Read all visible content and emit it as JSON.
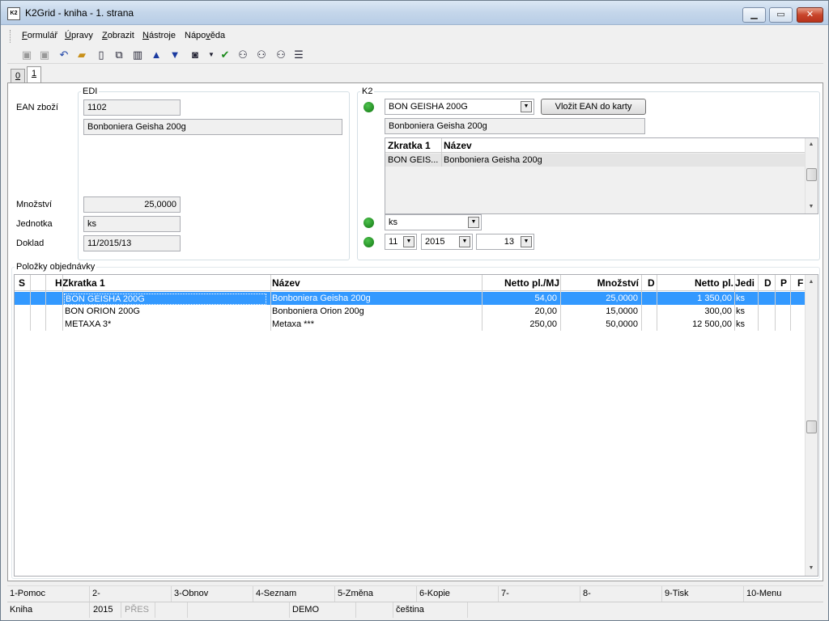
{
  "window": {
    "title": "K2Grid - kniha - 1. strana",
    "icon": "k2-app-icon"
  },
  "menu": [
    {
      "pre": "",
      "u": "F",
      "post": "ormulář"
    },
    {
      "pre": "",
      "u": "Ú",
      "post": "pravy"
    },
    {
      "pre": "",
      "u": "Z",
      "post": "obrazit"
    },
    {
      "pre": "",
      "u": "N",
      "post": "ástroje"
    },
    {
      "pre": "Nápo",
      "u": "v",
      "post": "ěda"
    }
  ],
  "tabs": [
    "0",
    "1"
  ],
  "edi": {
    "group_label": "EDI",
    "ean_label": "EAN zboží",
    "ean_value": "1102",
    "name_value": "Bonboniera Geisha 200g",
    "qty_label": "Množství",
    "qty_value": "25,0000",
    "unit_label": "Jednotka",
    "unit_value": "ks",
    "doc_label": "Doklad",
    "doc_value": "11/2015/13"
  },
  "k2": {
    "group_label": "K2",
    "product_combo": "BON GEISHA 200G",
    "ean_button": "Vložit EAN do karty",
    "name_value": "Bonboniera Geisha 200g",
    "mini_grid": {
      "headers": [
        "Zkratka 1",
        "Název"
      ],
      "rows": [
        [
          "BON GEIS...",
          "Bonboniera Geisha 200g"
        ]
      ]
    },
    "unit_combo": "ks",
    "doc_part1": "11",
    "doc_part2": "2015",
    "doc_part3": "13"
  },
  "items": {
    "group_label": "Položky objednávky",
    "headers": [
      "S",
      "H",
      "Zkratka 1",
      "Název",
      "Netto pl./MJ",
      "Množství",
      "D",
      "Netto pl.",
      "Jedi",
      "D",
      "P",
      "F"
    ],
    "rows": [
      {
        "code": "BON GEISHA 200G",
        "name": "Bonboniera Geisha 200g",
        "price": "54,00",
        "qty": "25,0000",
        "total": "1 350,00",
        "unit": "ks"
      },
      {
        "code": "BON ORION 200G",
        "name": "Bonboniera Orion 200g",
        "price": "20,00",
        "qty": "15,0000",
        "total": "300,00",
        "unit": "ks"
      },
      {
        "code": "METAXA 3*",
        "name": "Metaxa ***",
        "price": "250,00",
        "qty": "50,0000",
        "total": "12 500,00",
        "unit": "ks"
      }
    ]
  },
  "fkeys": [
    "1-Pomoc",
    "2-",
    "3-Obnov",
    "4-Seznam",
    "5-Změna",
    "6-Kopie",
    "7-",
    "8-",
    "9-Tisk",
    "10-Menu"
  ],
  "status": {
    "module": "Kniha",
    "year": "2015",
    "mode": "PŘES",
    "db": "DEMO",
    "lang": "čeština"
  }
}
